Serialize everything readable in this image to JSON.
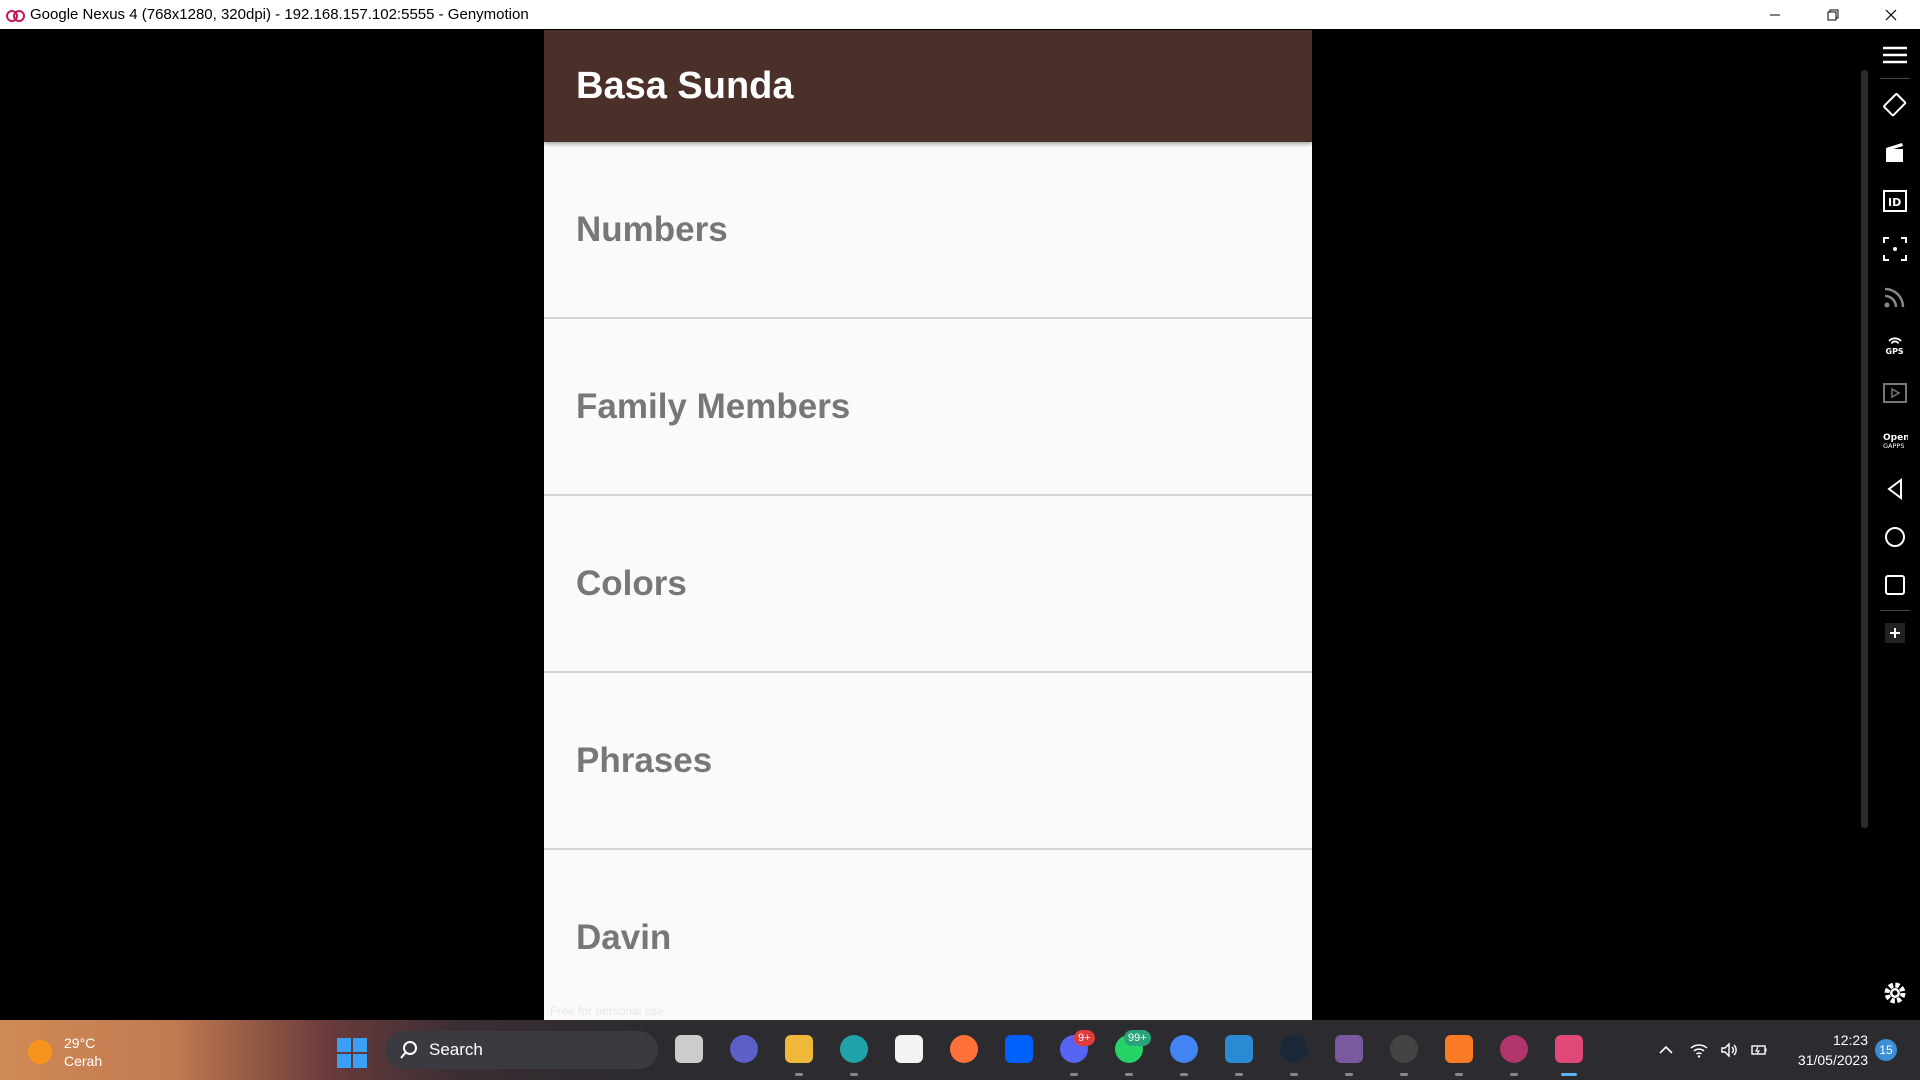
{
  "window": {
    "title": "Google Nexus 4 (768x1280, 320dpi) - 192.168.157.102:5555 - Genymotion"
  },
  "app": {
    "title": "Basa Sunda",
    "categories": [
      {
        "label": "Numbers"
      },
      {
        "label": "Family Members"
      },
      {
        "label": "Colors"
      },
      {
        "label": "Phrases"
      },
      {
        "label": "Davin"
      }
    ],
    "watermark": "Free for personal use"
  },
  "colors": {
    "appbar": "#4b302a",
    "list_bg": "#fafafa",
    "list_text": "#777777"
  },
  "toolbar": {
    "items": [
      "menu-icon",
      "rotate-icon",
      "camera-icon",
      "id-icon",
      "resize-icon",
      "network-icon",
      "gps-icon",
      "media-icon",
      "open-gapps-icon",
      "back-icon",
      "home-icon",
      "recents-icon",
      "add-icon",
      "settings-icon"
    ],
    "gps_label": "GPS",
    "open_gapps_label": "Open GAPPS"
  },
  "taskbar": {
    "weather_temp": "29°C",
    "weather_desc": "Cerah",
    "search_placeholder": "Search",
    "discord_badge": "9+",
    "whatsapp_badge": "99+",
    "time": "12:23",
    "date": "31/05/2023",
    "notifications": "15"
  }
}
